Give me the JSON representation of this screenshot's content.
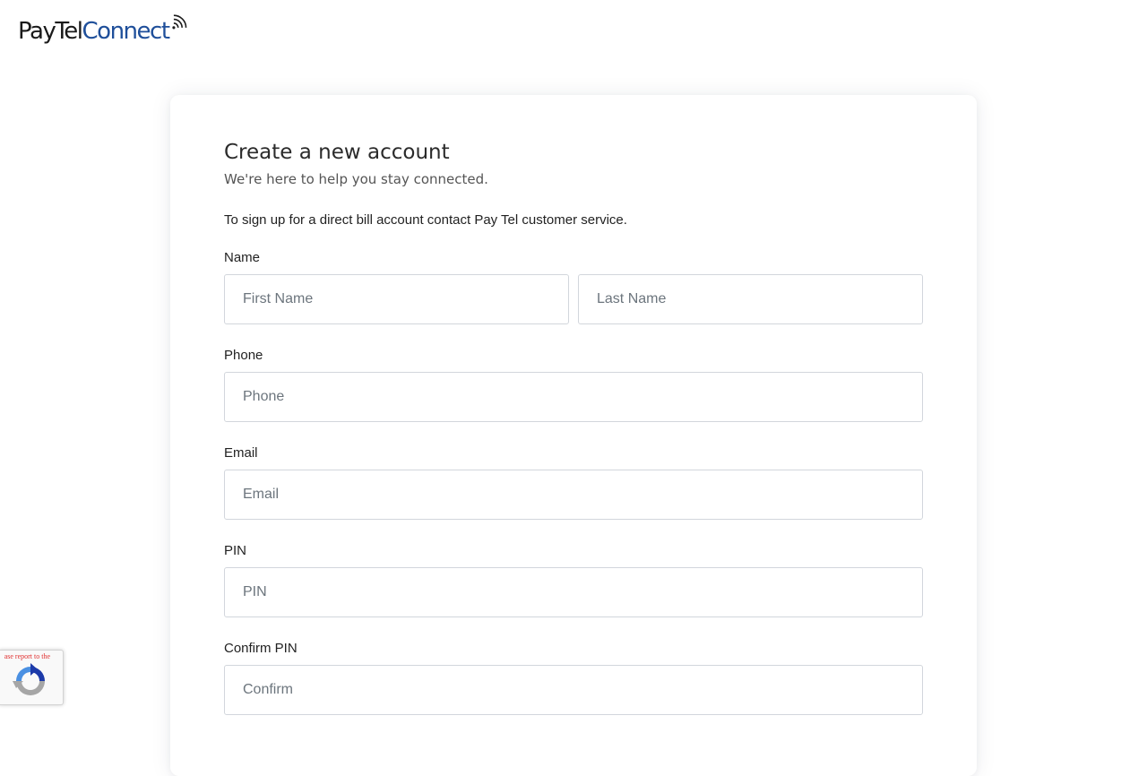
{
  "header": {
    "logo_part1": "PayTel",
    "logo_part2": "Connect"
  },
  "form": {
    "title": "Create a new account",
    "subtitle": "We're here to help you stay connected.",
    "notice": "To sign up for a direct bill account contact Pay Tel customer service.",
    "name": {
      "label": "Name",
      "first_placeholder": "First Name",
      "last_placeholder": "Last Name"
    },
    "phone": {
      "label": "Phone",
      "placeholder": "Phone"
    },
    "email": {
      "label": "Email",
      "placeholder": "Email"
    },
    "pin": {
      "label": "PIN",
      "placeholder": "PIN"
    },
    "confirm_pin": {
      "label": "Confirm PIN",
      "placeholder": "Confirm"
    }
  },
  "recaptcha": {
    "warning_text": "ase report to the",
    "icon": "recaptcha-icon"
  },
  "colors": {
    "brand_dark": "#1a1a1a",
    "brand_blue": "#1f4f9a",
    "input_border": "#d2d6dc",
    "warning_red": "#e03030"
  }
}
